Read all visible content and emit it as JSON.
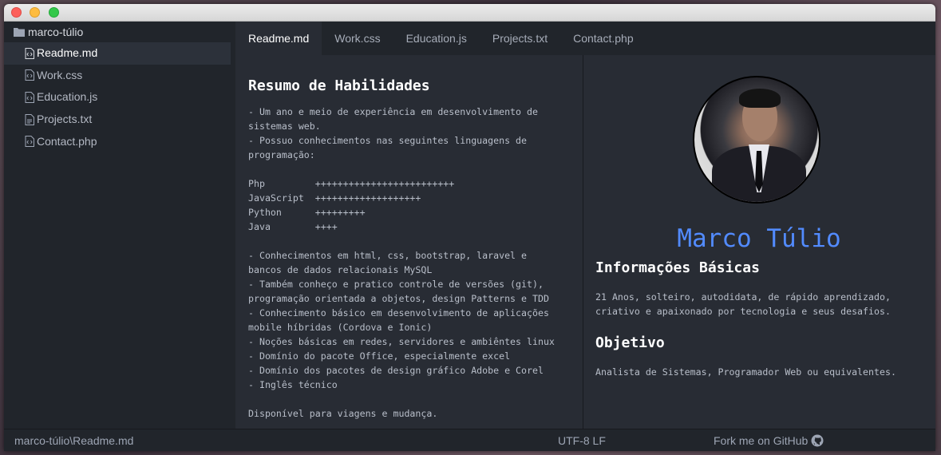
{
  "sidebar": {
    "root": "marco-túlio",
    "files": [
      "Readme.md",
      "Work.css",
      "Education.js",
      "Projects.txt",
      "Contact.php"
    ]
  },
  "tabs": [
    "Readme.md",
    "Work.css",
    "Education.js",
    "Projects.txt",
    "Contact.php"
  ],
  "readme": {
    "heading": "Resumo de Habilidades",
    "body": "- Um ano e meio de experiência em desenvolvimento de\nsistemas web.\n- Possuo conhecimentos nas seguintes linguagens de\nprogramação:\n\nPhp         +++++++++++++++++++++++++\nJavaScript  +++++++++++++++++++\nPython      +++++++++\nJava        ++++\n\n- Conhecimentos em html, css, bootstrap, laravel e\nbancos de dados relacionais MySQL\n- Também conheço e pratico controle de versões (git),\nprogramação orientada a objetos, design Patterns e TDD\n- Conhecimento básico em desenvolvimento de aplicações\nmobile híbridas (Cordova e Ionic)\n- Noções básicas em redes, servidores e ambiêntes linux\n- Domínio do pacote Office, especialmente excel\n- Domínio dos pacotes de design gráfico Adobe e Corel\n- Inglês técnico\n\nDisponível para viagens e mudança."
  },
  "profile": {
    "name": "Marco Túlio",
    "info_heading": "Informações Básicas",
    "info_text": "21 Anos, solteiro, autodidata, de rápido aprendizado,\ncriativo e apaixonado por tecnologia e seus desafios.",
    "goal_heading": "Objetivo",
    "goal_text": "Analista de Sistemas, Programador Web ou equivalentes."
  },
  "statusbar": {
    "path": "marco-túlio\\Readme.md",
    "encoding": "UTF-8 LF",
    "fork": "Fork me on GitHub"
  },
  "colors": {
    "accent": "#528bff",
    "background": "#282c34",
    "sidebar": "#21252b"
  },
  "icons": {
    "folder": "folder-icon",
    "file": "file-code-icon",
    "github": "github-icon"
  }
}
